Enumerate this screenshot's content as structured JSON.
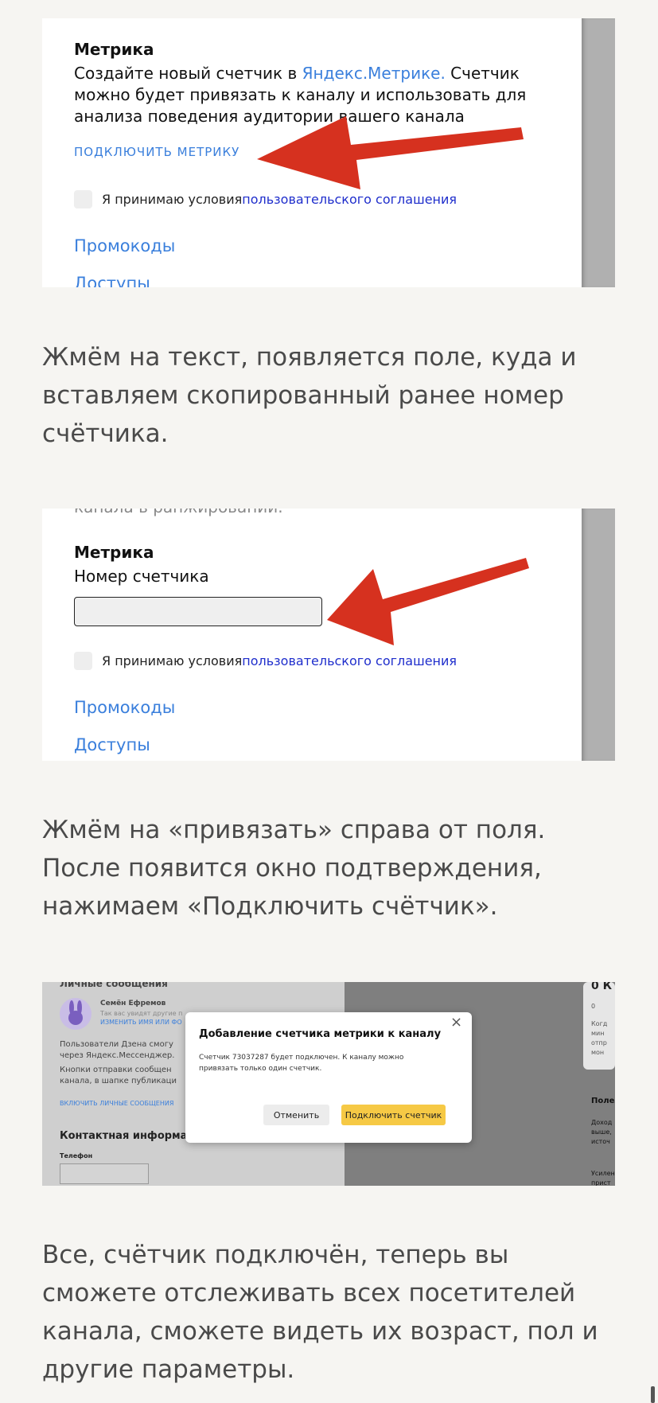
{
  "screenshot1": {
    "title": "Метрика",
    "desc_line1_pre": "Создайте новый счетчик в ",
    "desc_link": "Яндекс.Метрике.",
    "desc_line1_post": " Счетчик",
    "desc_line2": "можно будет привязать к каналу и использовать для",
    "desc_line3": "анализа поведения аудитории вашего канала",
    "connect_link": "ПОДКЛЮЧИТЬ МЕТРИКУ",
    "accept_text": "Я принимаю условия ",
    "accept_link": "пользовательского соглашения",
    "promo": "Промокоды",
    "access": "Доступы"
  },
  "paragraph1": "Жмём на текст, появляется поле, куда и вставляем скопированный ранее номер счётчика.",
  "screenshot2": {
    "cut_text": "канала в ранжировании.",
    "title": "Метрика",
    "field_label": "Номер счетчика",
    "field_value": "",
    "accept_text": "Я принимаю условия ",
    "accept_link": "пользовательского соглашения",
    "promo": "Промокоды",
    "access": "Доступы"
  },
  "paragraph2": "Жмём на «привязать» справа от поля. После появится окно подтверждения, нажимаем «Подключить счётчик».",
  "screenshot3": {
    "section_top": "Личные сообщения",
    "user_name": "Семён Ефремов",
    "user_sub": "Так вас увидят другие п",
    "change_link": "ИЗМЕНИТЬ ИМЯ ИЛИ ФО",
    "users_line1": "Пользователи Дзена смогу",
    "users_line2": "через Яндекс.Мессенджер.",
    "buttons_line1": "Кнопки отправки сообщен",
    "buttons_line2": "канала, в шапке публикаци",
    "enable_link": "ВКЛЮЧИТЬ ЛИЧНЫЕ СООБЩЕНИЯ",
    "contact_title": "Контактная информация",
    "phone_label": "Телефон",
    "right_big": "0 К",
    "right_zero": "0",
    "right_lines": [
      "Когд",
      "мин",
      "отпр",
      "мон"
    ],
    "right_head": "Полез",
    "right_lines2": [
      "Доход",
      "выше,",
      "источ"
    ],
    "right_bottom": [
      "Усилен",
      "прист"
    ],
    "modal_title": "Добавление счетчика метрики к каналу",
    "modal_text1": "Счетчик 73037287 будет подключен. К каналу можно",
    "modal_text2": "привязать только один счетчик.",
    "cancel_btn": "Отменить",
    "confirm_btn": "Подключить счетчик",
    "close_icon": "×"
  },
  "paragraph3": "Все, счётчик подключён, теперь вы сможете отслеживать всех посетителей канала, сможете видеть их возраст, пол и другие параметры.",
  "colors": {
    "accent_link": "#3a7fdc",
    "arrow_red": "#d6311f",
    "confirm_yellow": "#f6c945"
  }
}
